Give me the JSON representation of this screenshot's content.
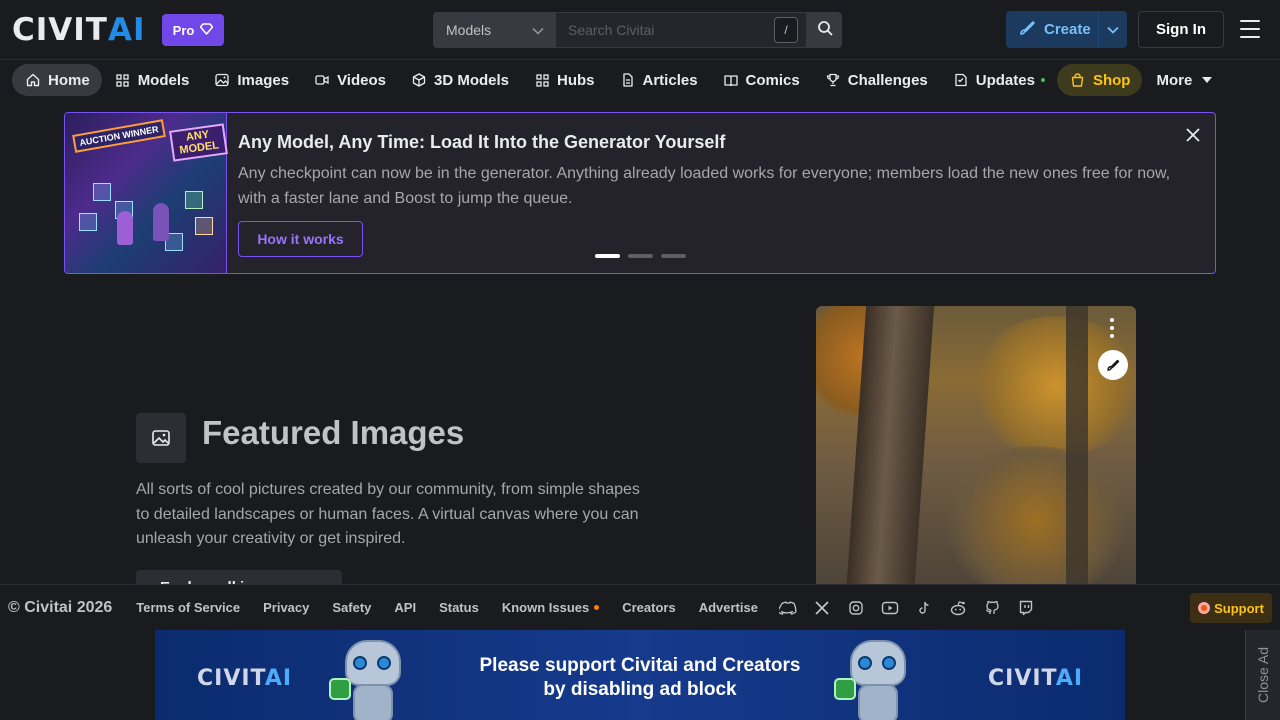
{
  "header": {
    "logo_civ": "CIVIT",
    "logo_ai": "AI",
    "pro_label": "Pro",
    "search_type": "Models",
    "search_placeholder": "Search Civitai",
    "search_shortcut": "/",
    "create_label": "Create",
    "signin_label": "Sign In"
  },
  "nav": {
    "items": [
      {
        "label": "Home",
        "icon": "home-icon"
      },
      {
        "label": "Models",
        "icon": "grid-icon"
      },
      {
        "label": "Images",
        "icon": "image-icon"
      },
      {
        "label": "Videos",
        "icon": "video-icon"
      },
      {
        "label": "3D Models",
        "icon": "cube-icon"
      },
      {
        "label": "Hubs",
        "icon": "grid-icon"
      },
      {
        "label": "Articles",
        "icon": "file-text-icon"
      },
      {
        "label": "Comics",
        "icon": "book-icon"
      },
      {
        "label": "Challenges",
        "icon": "trophy-icon"
      },
      {
        "label": "Updates",
        "icon": "updates-icon"
      },
      {
        "label": "Shop",
        "icon": "shopping-bag-icon"
      },
      {
        "label": "More",
        "icon": "caret-down-icon"
      }
    ]
  },
  "announcement": {
    "title": "Any Model, Any Time: Load It Into the Generator Yourself",
    "body": "Any checkpoint can now be in the generator. Anything already loaded works for everyone; members load the new ones free for now, with a faster lane and Boost to jump the queue.",
    "button": "How it works",
    "image_label_a": "AUCTION WINNER",
    "image_label_b": "ANY MODEL"
  },
  "featured": {
    "title": "Featured Images",
    "description": "All sorts of cool pictures created by our community, from simple shapes to detailed landscapes or human faces. A virtual canvas where you can unleash your creativity or get inspired.",
    "button": "Explore all images"
  },
  "footer": {
    "copyright": "© Civitai 2026",
    "links": [
      "Terms of Service",
      "Privacy",
      "Safety",
      "API",
      "Status",
      "Known Issues",
      "Creators",
      "Advertise"
    ],
    "social": [
      "discord-icon",
      "x-icon",
      "instagram-icon",
      "youtube-icon",
      "tiktok-icon",
      "reddit-icon",
      "github-icon",
      "twitch-icon"
    ],
    "support_label": "Support"
  },
  "ad": {
    "logo_civ": "CIVIT",
    "logo_ai": "AI",
    "text_line1": "Please support Civitai and Creators",
    "text_line2": "by disabling ad block",
    "close_label": "Close Ad"
  },
  "colors": {
    "background": "#1a1b1e",
    "accent_violet": "#7950f2",
    "accent_blue": "#228be6",
    "shop_yellow": "#fcc419"
  }
}
